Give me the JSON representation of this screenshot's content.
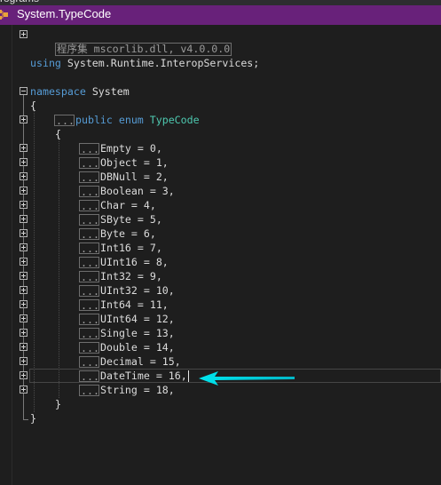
{
  "window": {
    "title_fragment": "rograms"
  },
  "tab": {
    "title": "System.TypeCode",
    "icon": "class-icon"
  },
  "editor": {
    "assembly_line": "程序集 mscorlib.dll, v4.0.0.0",
    "using_keyword": "using",
    "using_namespace": "System.Runtime.InteropServices;",
    "namespace_keyword": "namespace",
    "namespace_name": "System",
    "open_brace": "{",
    "close_brace": "}",
    "collapsed_marker": "...",
    "enum_modifiers": "public enum",
    "enum_name": "TypeCode",
    "members": [
      "Empty = 0,",
      "Object = 1,",
      "DBNull = 2,",
      "Boolean = 3,",
      "Char = 4,",
      "SByte = 5,",
      "Byte = 6,",
      "Int16 = 7,",
      "UInt16 = 8,",
      "Int32 = 9,",
      "UInt32 = 10,",
      "Int64 = 11,",
      "UInt64 = 12,",
      "Single = 13,",
      "Double = 14,",
      "Decimal = 15,",
      "DateTime = 16,",
      "String = 18,"
    ],
    "highlighted_member_index": 16,
    "annotation_arrow_color": "#00e5ee",
    "accent_color": "#68217a"
  }
}
